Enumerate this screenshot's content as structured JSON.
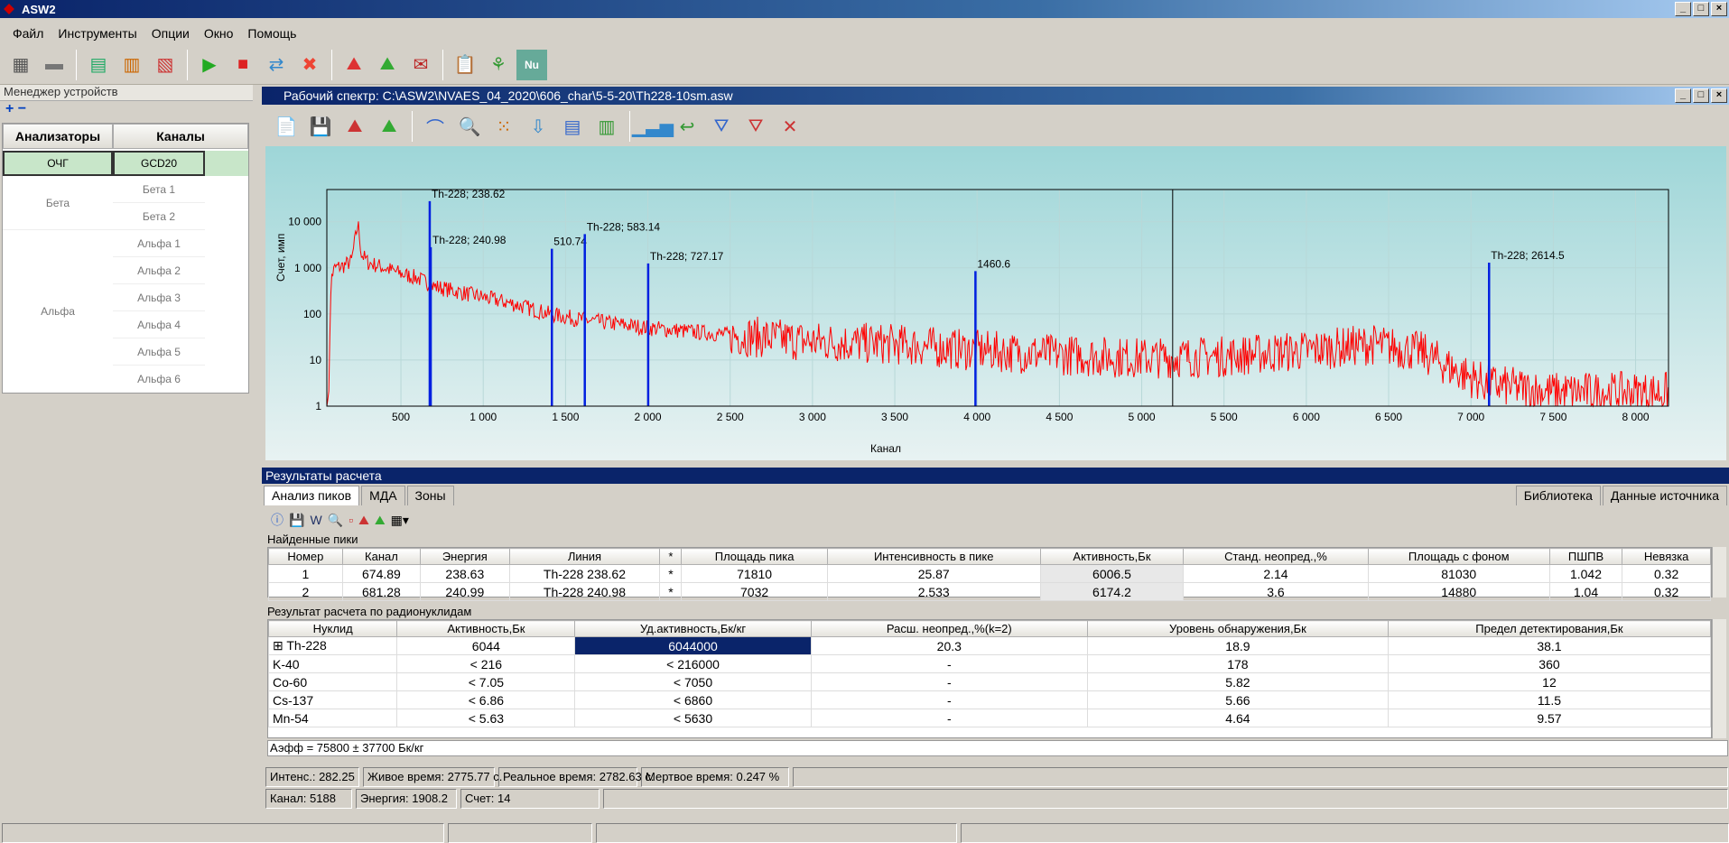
{
  "app": {
    "title": "ASW2"
  },
  "menu": [
    "Файл",
    "Инструменты",
    "Опции",
    "Окно",
    "Помощь"
  ],
  "device_manager": {
    "title": "Менеджер устройств",
    "col_analyzers": "Анализаторы",
    "col_channels": "Каналы",
    "analyzers": [
      {
        "name": "ОЧГ"
      },
      {
        "name": "Бета"
      },
      {
        "name": "Альфа"
      }
    ],
    "channels": [
      "GCD20",
      "Бета 1",
      "Бета 2",
      "Альфа 1",
      "Альфа 2",
      "Альфа 3",
      "Альфа 4",
      "Альфа 5",
      "Альфа 6"
    ]
  },
  "spectrum": {
    "title": "Рабочий спектр: C:\\ASW2\\NVAES_04_2020\\606_char\\5-5-20\\Th228-10sm.asw"
  },
  "chart_data": {
    "type": "line",
    "xlabel": "Канал",
    "ylabel": "Счет, имп",
    "x_range": [
      50,
      8200
    ],
    "y_range": [
      1,
      50000
    ],
    "y_scale": "log",
    "x_ticks": [
      500,
      1000,
      1500,
      2000,
      2500,
      3000,
      3500,
      4000,
      4500,
      5000,
      5500,
      6000,
      6500,
      7000,
      7500,
      8000
    ],
    "x_tick_labels": [
      "500",
      "1 000",
      "1 500",
      "2 000",
      "2 500",
      "3 000",
      "3 500",
      "4 000",
      "4 500",
      "5 000",
      "5 500",
      "6 000",
      "6 500",
      "7 000",
      "7 500",
      "8 000"
    ],
    "y_ticks": [
      1,
      10,
      100,
      1000,
      10000
    ],
    "y_tick_labels": [
      "1",
      "10",
      "100",
      "1 000",
      "10 000"
    ],
    "cursor_channel": 5188,
    "series": [
      {
        "color": "#ff0000",
        "points": [
          [
            60,
            1
          ],
          [
            70,
            100
          ],
          [
            80,
            700
          ],
          [
            100,
            1000
          ],
          [
            150,
            1100
          ],
          [
            200,
            1400
          ],
          [
            230,
            6000
          ],
          [
            240,
            9000
          ],
          [
            260,
            2000
          ],
          [
            300,
            1300
          ],
          [
            400,
            1000
          ],
          [
            500,
            750
          ],
          [
            600,
            600
          ],
          [
            700,
            400
          ],
          [
            800,
            330
          ],
          [
            1000,
            230
          ],
          [
            1200,
            160
          ],
          [
            1400,
            100
          ],
          [
            1600,
            75
          ],
          [
            2000,
            50
          ],
          [
            2500,
            35
          ],
          [
            3000,
            25
          ],
          [
            3500,
            22
          ],
          [
            4000,
            16
          ],
          [
            4500,
            13
          ],
          [
            5000,
            11
          ],
          [
            5500,
            12
          ],
          [
            6000,
            16
          ],
          [
            6400,
            22
          ],
          [
            6700,
            15
          ],
          [
            6900,
            6
          ],
          [
            7100,
            3
          ],
          [
            7500,
            2
          ],
          [
            8200,
            2
          ]
        ]
      }
    ],
    "peaks": [
      {
        "x": 675,
        "y": 28000,
        "label": "Th-228; 238.62"
      },
      {
        "x": 681,
        "y": 2800,
        "label": "Th-228; 240.98"
      },
      {
        "x": 1417,
        "y": 2600,
        "label": "510.74"
      },
      {
        "x": 1617,
        "y": 5400,
        "label": "Th-228; 583.14"
      },
      {
        "x": 2002,
        "y": 1250,
        "label": "Th-228; 727.17"
      },
      {
        "x": 3990,
        "y": 850,
        "label": "1460.6"
      },
      {
        "x": 7110,
        "y": 1300,
        "label": "Th-228; 2614.5"
      }
    ]
  },
  "results": {
    "title": "Результаты расчета",
    "tabs": [
      "Анализ пиков",
      "МДА",
      "Зоны"
    ],
    "right_tabs": [
      "Библиотека",
      "Данные источника"
    ],
    "found_peaks_label": "Найденные пики",
    "peak_cols": [
      "Номер",
      "Канал",
      "Энергия",
      "Линия",
      "*",
      "Площадь пика",
      "Интенсивность в пике",
      "Активность,Бк",
      "Станд. неопред.,%",
      "Площадь с фоном",
      "ПШПВ",
      "Невязка"
    ],
    "peak_rows": [
      [
        "1",
        "674.89",
        "238.63",
        "Th-228   238.62",
        "*",
        "71810",
        "25.87",
        "6006.5",
        "2.14",
        "81030",
        "1.042",
        "0.32"
      ],
      [
        "2",
        "681.28",
        "240.99",
        "Th-228   240.98",
        "*",
        "7032",
        "2.533",
        "6174.2",
        "3.6",
        "14880",
        "1.04",
        "0.32"
      ]
    ],
    "nuclide_label": "Результат  расчета по радионуклидам",
    "nuc_cols": [
      "Нуклид",
      "Активность,Бк",
      "Уд.активность,Бк/кг",
      "Расш. неопред.,%(k=2)",
      "Уровень обнаружения,Бк",
      "Предел детектирования,Бк"
    ],
    "nuc_rows": [
      [
        "Th-228",
        "6044",
        "6044000",
        "20.3",
        "18.9",
        "38.1"
      ],
      [
        "K-40",
        "< 216",
        "< 216000",
        "-",
        "178",
        "360"
      ],
      [
        "Co-60",
        "< 7.05",
        "< 7050",
        "-",
        "5.82",
        "12"
      ],
      [
        "Cs-137",
        "< 6.86",
        "< 6860",
        "-",
        "5.66",
        "11.5"
      ],
      [
        "Mn-54",
        "< 5.63",
        "< 5630",
        "-",
        "4.64",
        "9.57"
      ]
    ],
    "aeff": "Аэфф = 75800 ± 37700 Бк/кг"
  },
  "status": {
    "intens": "Интенс.: 282.25",
    "live": "Живое время: 2775.77 с.",
    "real": "Реальное время:  2782.63 с.",
    "dead": "Мертвое время:  0.247 %",
    "channel": "Канал: 5188",
    "energy": "Энергия: 1908.2",
    "count": "Счет: 14"
  }
}
